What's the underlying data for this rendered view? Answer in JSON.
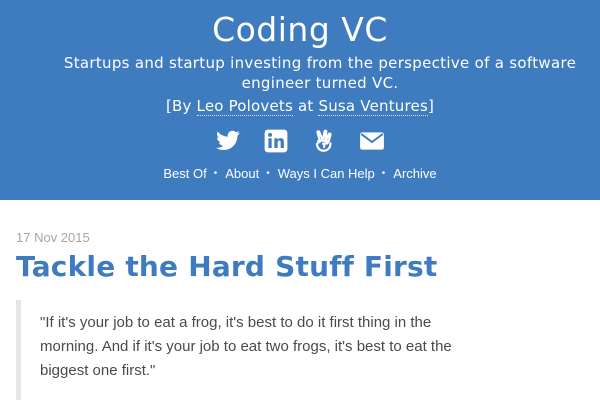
{
  "header": {
    "title": "Coding VC",
    "description": "Startups and startup investing from the perspective of a software engineer turned VC.",
    "byline": {
      "prefix": "[By ",
      "author": "Leo Polovets",
      "middle": " at ",
      "company": "Susa Ventures",
      "suffix": "]"
    },
    "social": [
      {
        "icon": "twitter-icon"
      },
      {
        "icon": "linkedin-icon"
      },
      {
        "icon": "angellist-icon"
      },
      {
        "icon": "email-icon"
      }
    ],
    "nav": [
      {
        "label": "Best Of"
      },
      {
        "label": "About"
      },
      {
        "label": "Ways I Can Help"
      },
      {
        "label": "Archive"
      }
    ],
    "nav_separator": "•"
  },
  "post": {
    "date": "17 Nov 2015",
    "title": "Tackle the Hard Stuff First",
    "quote": "\"If it's your job to eat a frog, it's best to do it first thing in the morning. And if it's your job to eat two frogs, it's best to eat the biggest one first.\""
  },
  "colors": {
    "header_bg": "#3f7bbf",
    "title_accent": "#3f7bbf",
    "date_gray": "#a5a5a5",
    "quote_bar": "#e6e6e6"
  }
}
